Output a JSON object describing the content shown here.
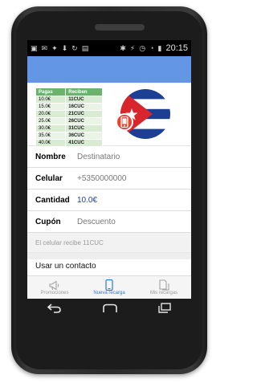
{
  "status_bar": {
    "time": "20:15"
  },
  "rates_table": {
    "headers": [
      "Pagas",
      "Reciben"
    ],
    "rows": [
      [
        "10.0€",
        "11CUC"
      ],
      [
        "15.0€",
        "16CUC"
      ],
      [
        "20.0€",
        "21CUC"
      ],
      [
        "25.0€",
        "26CUC"
      ],
      [
        "30.0€",
        "31CUC"
      ],
      [
        "35.0€",
        "36CUC"
      ],
      [
        "40.0€",
        "41CUC"
      ]
    ]
  },
  "form": {
    "destinatario": {
      "label": "Nombre",
      "value": "Destinatario"
    },
    "celular": {
      "label": "Celular",
      "value": "+5350000000"
    },
    "cantidad": {
      "label": "Cantidad",
      "value": "10.0€"
    },
    "cupon": {
      "label": "Cupón",
      "value": "Descuento"
    }
  },
  "info_text": "El celular recibe 11CUC",
  "contact_text": "Usar un contacto",
  "bottom_nav": [
    {
      "label": "Promociones",
      "icon": "megaphone-icon",
      "active": false
    },
    {
      "label": "Nueva recarga",
      "icon": "phone-icon",
      "active": true
    },
    {
      "label": "Mis recargas",
      "icon": "documents-icon",
      "active": false
    }
  ],
  "colors": {
    "app_bar": "#6496e6",
    "accent": "#2f78d8",
    "table_header": "#6bb36b",
    "flag_red": "#d8262c",
    "flag_blue": "#1c3f94"
  }
}
